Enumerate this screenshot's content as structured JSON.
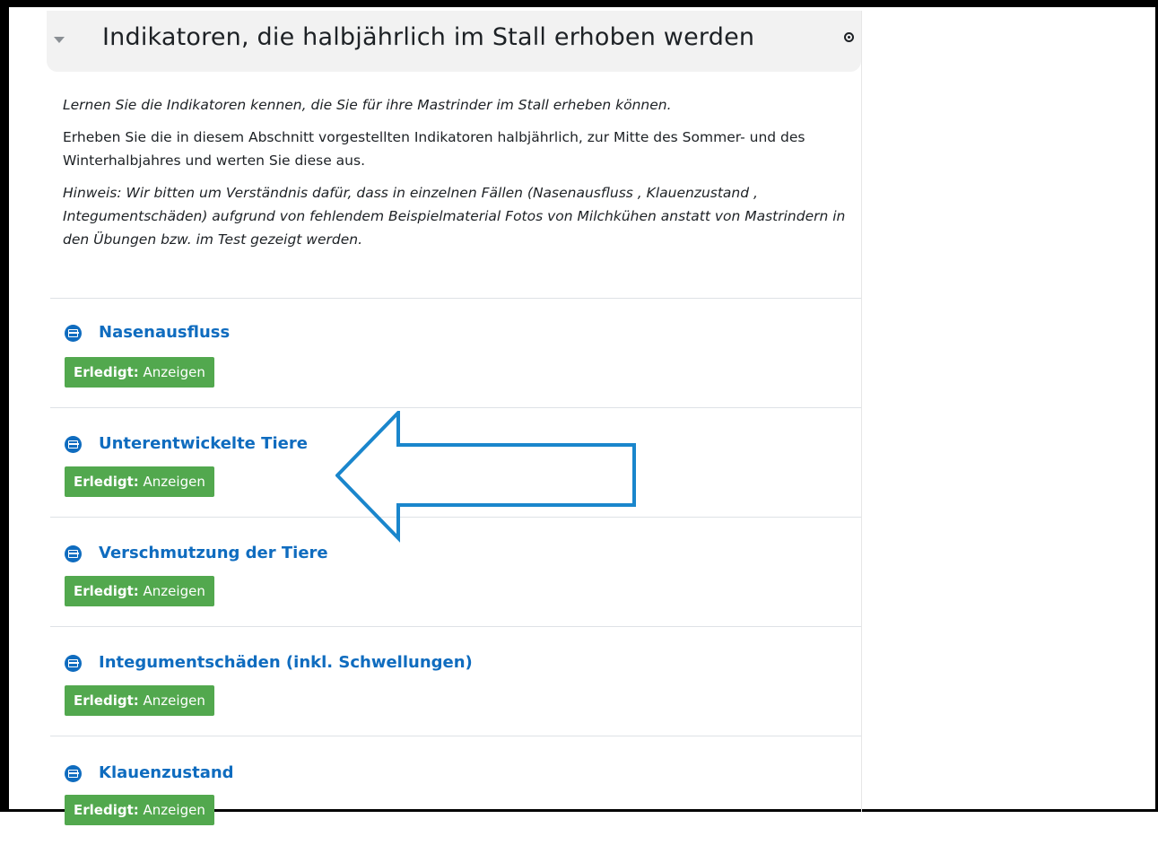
{
  "section": {
    "title": "Indikatoren, die halbjährlich im Stall erhoben werden",
    "summary": {
      "lead": "Lernen Sie die Indikatoren kennen, die Sie für ihre Mastrinder im Stall erheben können.",
      "body": "Erheben Sie die in diesem Abschnitt vorgestellten Indikatoren halbjährlich, zur Mitte des Sommer- und des Winterhalbjahres und werten Sie diese aus.",
      "hint": "Hinweis: Wir bitten um Verständnis dafür, dass in einzelnen Fällen (Nasenausfluss , Klauenzustand , Integumentschäden) aufgrund von fehlendem Beispielmaterial Fotos von Milchkühen anstatt von Mastrindern in den Übungen bzw. im Test gezeigt werden."
    },
    "activities": [
      {
        "name": "Nasenausfluss",
        "status_label": "Erledigt:",
        "status_value": "Anzeigen"
      },
      {
        "name": "Unterentwickelte Tiere",
        "status_label": "Erledigt:",
        "status_value": "Anzeigen"
      },
      {
        "name": "Verschmutzung der Tiere",
        "status_label": "Erledigt:",
        "status_value": "Anzeigen"
      },
      {
        "name": "Integumentschäden (inkl. Schwellungen)",
        "status_label": "Erledigt:",
        "status_value": "Anzeigen"
      },
      {
        "name": "Klauenzustand",
        "status_label": "Erledigt:",
        "status_value": "Anzeigen"
      }
    ]
  },
  "icons": {
    "collapse": "chevron-down-icon",
    "highlight": "target-icon",
    "activity": "page-icon",
    "annotation": "arrow-left-outline"
  },
  "colors": {
    "link": "#0f6cbf",
    "badge": "#52a84e",
    "annotation_arrow": "#1a86cc",
    "header_bg": "#f2f2f2"
  }
}
